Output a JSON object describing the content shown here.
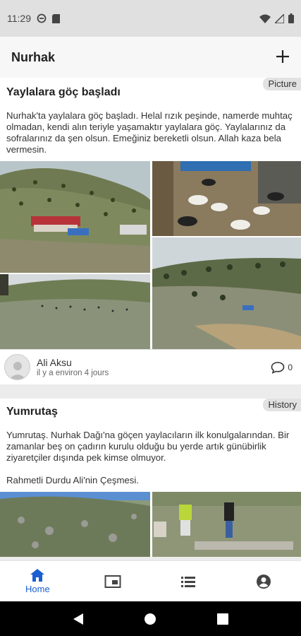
{
  "statusbar": {
    "time": "11:29"
  },
  "appbar": {
    "title": "Nurhak",
    "add_icon": "plus-icon"
  },
  "posts": [
    {
      "category": "Picture",
      "title": "Yaylalara göç başladı",
      "body": "Nurhak'ta yaylalara göç başladı. Helal rızık peşinde, namerde muhtaç olmadan, kendi alın teriyle yaşamaktır yaylalara göç. Yaylalarınız da sofralarınız da şen olsun. Emeğiniz bereketli olsun. Allah kaza bela vermesin.",
      "author": "Ali Aksu",
      "time": "il y a environ 4 jours",
      "comment_count": "0"
    },
    {
      "category": "History",
      "title": "Yumrutaş",
      "body": "Yumrutaş. Nurhak Dağı'na göçen yaylacıların ilk konulgalarından. Bir zamanlar beş on çadırın kurulu olduğu bu yerde artık günübirlik ziyaretçiler dışında pek kimse olmuyor.\n\nRahmetli Durdu Ali'nin Çeşmesi."
    }
  ],
  "bottomnav": [
    {
      "label": "Home",
      "icon": "home-icon",
      "active": true
    },
    {
      "label": "",
      "icon": "gallery-icon",
      "active": false
    },
    {
      "label": "",
      "icon": "list-icon",
      "active": false
    },
    {
      "label": "",
      "icon": "account-icon",
      "active": false
    }
  ],
  "colors": {
    "accent": "#1a5fd1",
    "tag_bg": "#e2e2e2"
  }
}
